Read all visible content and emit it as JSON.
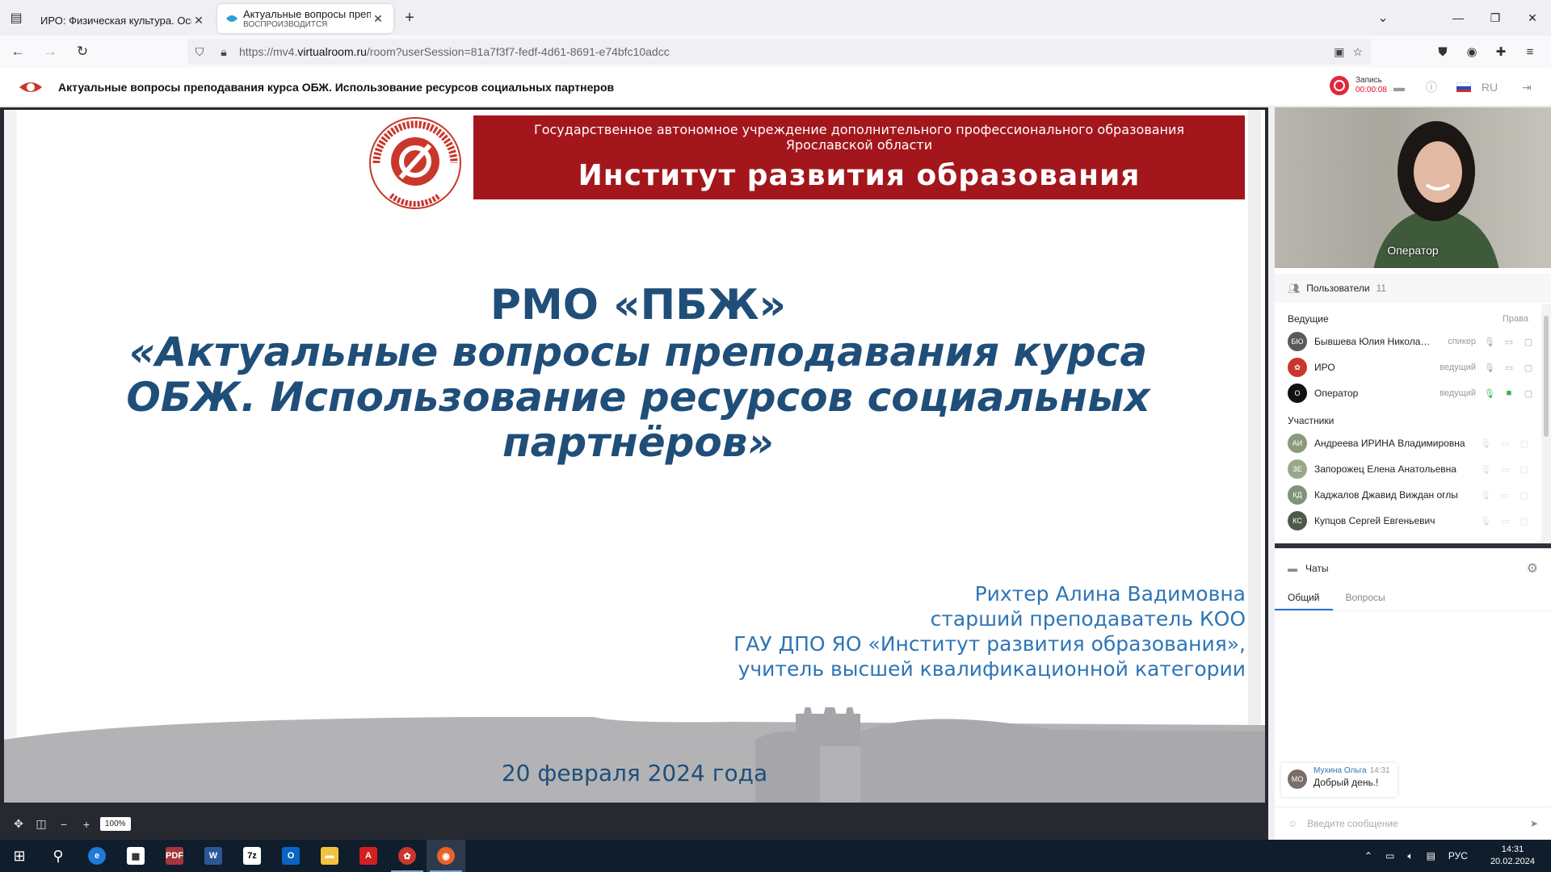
{
  "browser": {
    "tabs": [
      {
        "title": "ИРО: Физическая культура. Основ",
        "active": false
      },
      {
        "title": "Актуальные вопросы препода",
        "subtitle": "ВОСПРОИЗВОДИТСЯ",
        "active": true
      }
    ],
    "url_prefix": "https://mv4.",
    "url_domain": "virtualroom.ru",
    "url_rest": "/room?userSession=81a7f3f7-fedf-4d61-8691-e74bfc10adcc"
  },
  "app": {
    "title": "Актуальные вопросы преподавания курса ОБЖ. Использование ресурсов социальных партнеров",
    "record_label": "Запись",
    "record_time": "00:00:08",
    "language": "RU"
  },
  "slide": {
    "banner_line1": "Государственное автономное учреждение дополнительного профессионального образования",
    "banner_line2": "Ярославской области",
    "banner_line3": "Институт развития образования",
    "seal_text": "ИНСТИТУТ РАЗВИТИЯ ОБРАЗОВАНИЯ · ГАУ ДПО ЯО",
    "title1": "РМО «ПБЖ»",
    "title2": "«Актуальные вопросы преподавания курса",
    "title3": "ОБЖ. Использование ресурсов социальных",
    "title4": "партнёров»",
    "author1": "Рихтер Алина Вадимовна",
    "author2": "старший преподаватель КОО",
    "author3": "ГАУ ДПО ЯО «Институт развития образования»,",
    "author4": "учитель высшей квалификационной категории",
    "date": "20 февраля 2024 года"
  },
  "controls": {
    "zoom": "100%"
  },
  "video": {
    "name": "Оператор"
  },
  "users": {
    "header": "Пользователи",
    "count": "11",
    "hosts_label": "Ведущие",
    "rights_label": "Права",
    "hosts": [
      {
        "initials": "БЮ",
        "name": "Бывшева Юлия Никола…",
        "role": "спикер",
        "color": "#5a5a5a"
      },
      {
        "initials": "",
        "name": "ИРО",
        "role": "ведущий",
        "color": "#c9372c"
      },
      {
        "initials": "О",
        "name": "Оператор",
        "role": "ведущий",
        "color": "#111111"
      }
    ],
    "participants_label": "Участники",
    "participants": [
      {
        "initials": "АИ",
        "name": "Андреева ИРИНА Владимировна",
        "color": "#8a9a7a"
      },
      {
        "initials": "ЗЕ",
        "name": "Запорожец Елена Анатольевна",
        "color": "#9aa88a"
      },
      {
        "initials": "КД",
        "name": "Каджалов Джавид Виждан оглы",
        "color": "#7f9478"
      },
      {
        "initials": "КС",
        "name": "Купцов Сергей Евгеньевич",
        "color": "#4d5a4a"
      }
    ]
  },
  "chats": {
    "header": "Чаты",
    "tab_general": "Общий",
    "tab_questions": "Вопросы",
    "messages": [
      {
        "initials": "МО",
        "author": "Мухина Ольга",
        "time": "14:31",
        "text": "Добрый день.!"
      }
    ],
    "input_placeholder": "Введите сообщение"
  },
  "taskbar": {
    "lang": "РУС",
    "time": "14:31",
    "date": "20.02.2024"
  }
}
